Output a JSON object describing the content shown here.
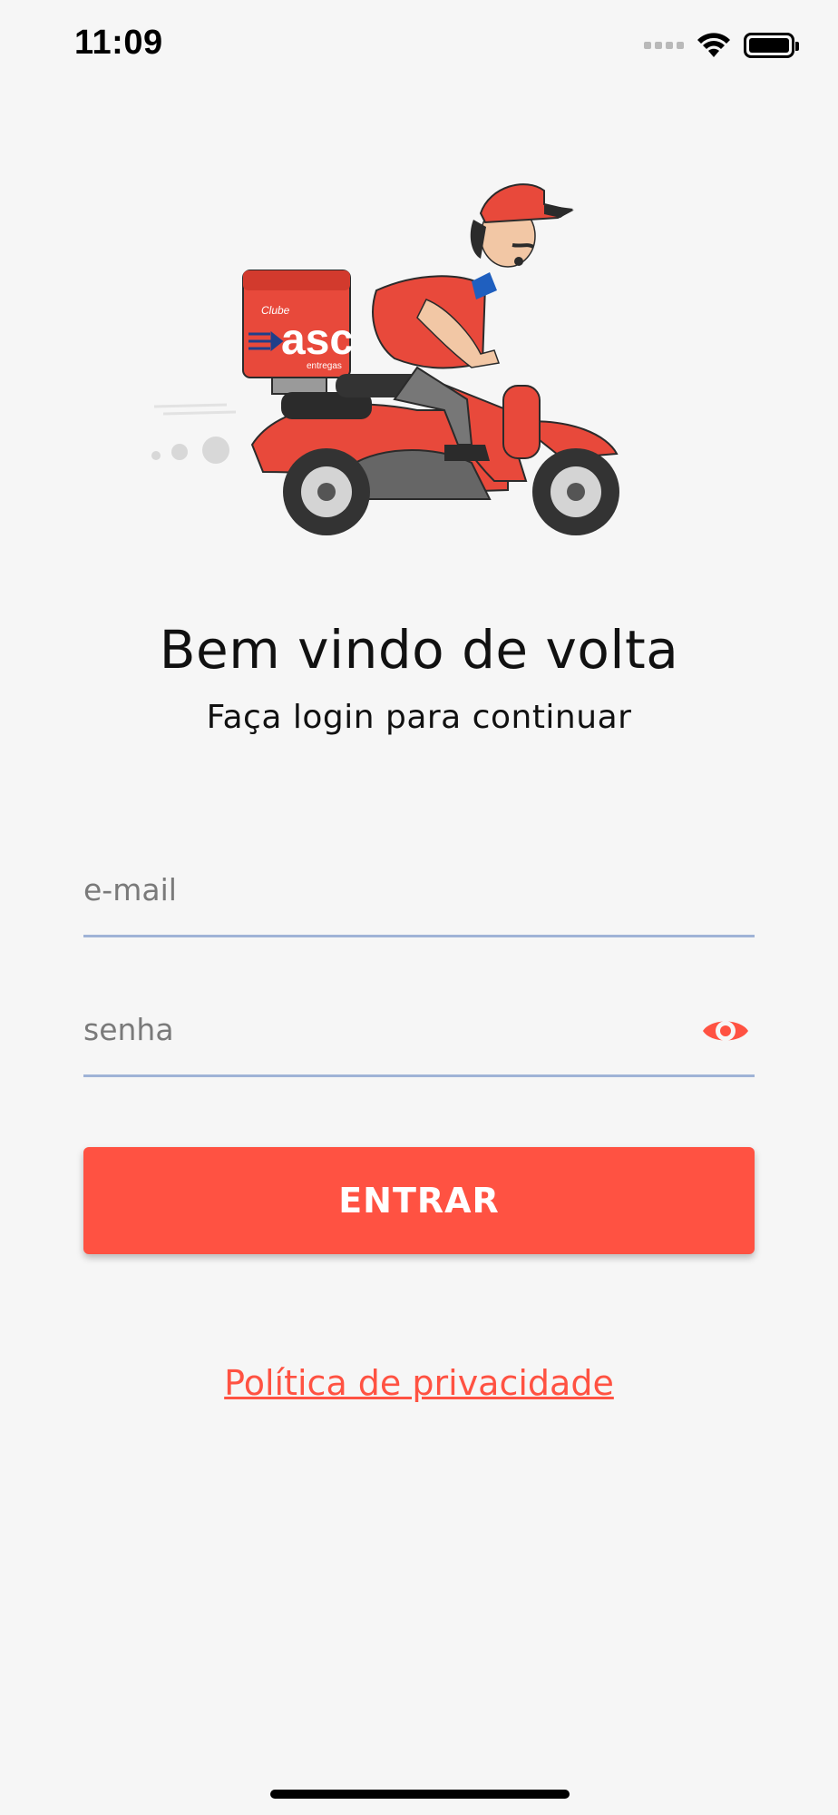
{
  "status": {
    "time": "11:09"
  },
  "logo": {
    "line1": "Clube",
    "line2": "asc",
    "line3": "entregas"
  },
  "login": {
    "title": "Bem vindo de volta",
    "subtitle": "Faça login para continuar",
    "email_placeholder": "e-mail",
    "password_placeholder": "senha",
    "submit_label": "ENTRAR",
    "privacy_link": "Política de privacidade"
  },
  "colors": {
    "accent": "#ff5242",
    "underline": "#9fb3d6",
    "background": "#f6f6f6"
  },
  "icons": {
    "password_toggle": "eye-icon",
    "wifi": "wifi-icon",
    "battery": "battery-icon",
    "signal": "signal-icon"
  }
}
